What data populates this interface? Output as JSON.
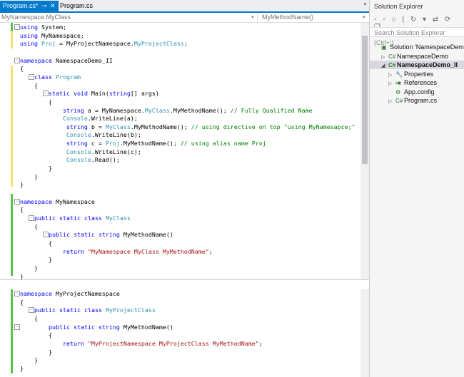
{
  "tabs": {
    "active": "Program.cs*",
    "pin": "⊸",
    "close": "✕",
    "other": "Program.cs",
    "dropdown": "▾"
  },
  "navbar": {
    "type_selector": "MyNamespace.MyClass",
    "member_selector": "MyMethodName()",
    "drop": "▾"
  },
  "code_top": [
    [
      [
        "using",
        "kw"
      ],
      [
        " System;",
        ""
      ]
    ],
    [
      [
        "using",
        "kw"
      ],
      [
        " MyNamespace;",
        ""
      ]
    ],
    [
      [
        "using",
        "kw"
      ],
      [
        " ",
        ""
      ],
      [
        "Proj",
        "ty"
      ],
      [
        " = MyProjectNamespace.",
        ""
      ],
      [
        "MyProjectClass",
        "ty"
      ],
      [
        ";",
        ""
      ]
    ],
    [],
    [
      [
        "namespace",
        "kw"
      ],
      [
        " NamespaceDemo_II",
        ""
      ]
    ],
    [
      [
        "{",
        ""
      ]
    ],
    [
      [
        "    ",
        ""
      ],
      [
        "class",
        "kw"
      ],
      [
        " ",
        ""
      ],
      [
        "Program",
        "ty"
      ]
    ],
    [
      [
        "    {",
        ""
      ]
    ],
    [
      [
        "        ",
        ""
      ],
      [
        "static",
        "kw"
      ],
      [
        " ",
        ""
      ],
      [
        "void",
        "kw"
      ],
      [
        " Main(",
        ""
      ],
      [
        "string",
        "kw"
      ],
      [
        "[] args)",
        ""
      ]
    ],
    [
      [
        "        {",
        ""
      ]
    ],
    [
      [
        "            ",
        ""
      ],
      [
        "string",
        "kw"
      ],
      [
        " a = MyNamespace.",
        ""
      ],
      [
        "MyClass",
        "ty"
      ],
      [
        ".MyMethodName(); ",
        ""
      ],
      [
        "// Fully Qualified Name",
        "cm"
      ]
    ],
    [
      [
        "            ",
        ""
      ],
      [
        "Console",
        "ty"
      ],
      [
        ".WriteLine(a);",
        ""
      ]
    ],
    [
      [
        "             ",
        ""
      ],
      [
        "string",
        "kw"
      ],
      [
        " b = ",
        ""
      ],
      [
        "MyClass",
        "ty"
      ],
      [
        ".MyMethodName(); ",
        ""
      ],
      [
        "// using directive on top \"using MyNamesapce;\"",
        "cm"
      ]
    ],
    [
      [
        "             ",
        ""
      ],
      [
        "Console",
        "ty"
      ],
      [
        ".WriteLine(b);",
        ""
      ]
    ],
    [
      [
        "             ",
        ""
      ],
      [
        "string",
        "kw"
      ],
      [
        " c = ",
        ""
      ],
      [
        "Proj",
        "ty"
      ],
      [
        ".MyMethodName(); ",
        ""
      ],
      [
        "// using alias name Proj",
        "cm"
      ]
    ],
    [
      [
        "             ",
        ""
      ],
      [
        "Console",
        "ty"
      ],
      [
        ".WriteLine(c);",
        ""
      ]
    ],
    [
      [
        "             ",
        ""
      ],
      [
        "Console",
        "ty"
      ],
      [
        ".Read();",
        ""
      ]
    ],
    [
      [
        "        }",
        ""
      ]
    ],
    [
      [
        "    }",
        ""
      ]
    ],
    [
      [
        "}",
        ""
      ]
    ],
    [],
    [
      [
        "namespace",
        "kw"
      ],
      [
        " MyNamespace",
        ""
      ]
    ],
    [
      [
        "{",
        ""
      ]
    ],
    [
      [
        "    ",
        ""
      ],
      [
        "public",
        "kw"
      ],
      [
        " ",
        ""
      ],
      [
        "static",
        "kw"
      ],
      [
        " ",
        ""
      ],
      [
        "class",
        "kw"
      ],
      [
        " ",
        ""
      ],
      [
        "MyClass",
        "ty"
      ]
    ],
    [
      [
        "    {",
        ""
      ]
    ],
    [
      [
        "        ",
        ""
      ],
      [
        "public",
        "kw"
      ],
      [
        " ",
        ""
      ],
      [
        "static",
        "kw"
      ],
      [
        " ",
        ""
      ],
      [
        "string",
        "kw"
      ],
      [
        " MyMethodName()",
        ""
      ]
    ],
    [
      [
        "        {",
        ""
      ]
    ],
    [
      [
        "            ",
        ""
      ],
      [
        "return",
        "kw"
      ],
      [
        " ",
        ""
      ],
      [
        "\"MyNamespace MyClass MyMethodName\"",
        "st"
      ],
      [
        ";",
        ""
      ]
    ],
    [
      [
        "        }",
        ""
      ]
    ],
    [
      [
        "    }",
        ""
      ]
    ],
    [
      [
        "}",
        ""
      ]
    ]
  ],
  "code_bottom": [
    [
      [
        "namespace",
        "kw"
      ],
      [
        " MyProjectNamespace",
        ""
      ]
    ],
    [
      [
        "{",
        ""
      ]
    ],
    [
      [
        "    ",
        ""
      ],
      [
        "public",
        "kw"
      ],
      [
        " ",
        ""
      ],
      [
        "static",
        "kw"
      ],
      [
        " ",
        ""
      ],
      [
        "class",
        "kw"
      ],
      [
        " ",
        ""
      ],
      [
        "MyProjectClass",
        "ty"
      ]
    ],
    [
      [
        "    {",
        ""
      ]
    ],
    [
      [
        "        ",
        ""
      ],
      [
        "public",
        "kw"
      ],
      [
        " ",
        ""
      ],
      [
        "static",
        "kw"
      ],
      [
        " ",
        ""
      ],
      [
        "string",
        "kw"
      ],
      [
        " MyMethodName()",
        ""
      ]
    ],
    [
      [
        "        {",
        ""
      ]
    ],
    [
      [
        "            ",
        ""
      ],
      [
        "return",
        "kw"
      ],
      [
        " ",
        ""
      ],
      [
        "\"MyProjectNamespace MyProjectClass MyMethodName\"",
        "st"
      ],
      [
        ";",
        ""
      ]
    ],
    [
      [
        "        }",
        ""
      ]
    ],
    [
      [
        "    }",
        ""
      ]
    ],
    [
      [
        "}",
        ""
      ]
    ]
  ],
  "solution_explorer": {
    "title": "Solution Explorer",
    "toolbar_icons": "◦ ◦ ⌂ | ↻ ▾ ⇄ ⟳ ❐",
    "search_placeholder": "Search Solution Explorer (Ctrl+;)",
    "nodes": [
      {
        "label": "Solution 'NamespaceDemo'",
        "arrow": "",
        "icon": "▣"
      },
      {
        "label": "NamespaceDemo",
        "arrow": "▷",
        "icon": "C#"
      },
      {
        "label": "NamespaceDemo_II",
        "arrow": "◢",
        "icon": "C#"
      },
      {
        "label": "Properties",
        "arrow": "▷",
        "icon": "🔧"
      },
      {
        "label": "References",
        "arrow": "▷",
        "icon": "▪■"
      },
      {
        "label": "App.config",
        "arrow": "",
        "icon": "⚙"
      },
      {
        "label": "Program.cs",
        "arrow": "▷",
        "icon": "C#"
      }
    ]
  }
}
